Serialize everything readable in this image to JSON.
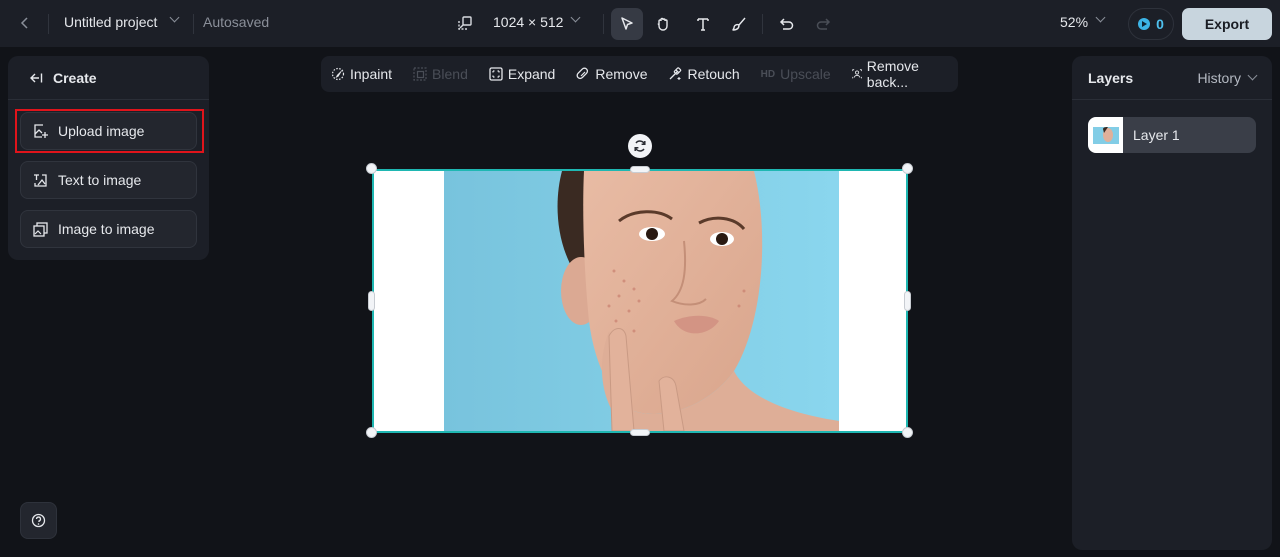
{
  "topbar": {
    "back_icon": "chevron-left-icon",
    "project_title": "Untitled project",
    "save_status": "Autosaved",
    "canvas_size": "1024 × 512",
    "tools": [
      {
        "name": "select",
        "icon": "cursor-icon",
        "active": true
      },
      {
        "name": "hand",
        "icon": "hand-icon",
        "active": false
      },
      {
        "name": "text",
        "icon": "text-icon",
        "active": false
      },
      {
        "name": "brush",
        "icon": "brush-icon",
        "active": false
      },
      {
        "name": "undo",
        "icon": "undo-icon",
        "active": false
      },
      {
        "name": "redo",
        "icon": "redo-icon",
        "active": false,
        "disabled": true
      }
    ],
    "zoom": "52%",
    "credits": "0",
    "export_label": "Export"
  },
  "left_panel": {
    "title": "Create",
    "items": [
      {
        "label": "Upload image",
        "icon": "upload-image-icon",
        "highlighted": true
      },
      {
        "label": "Text to image",
        "icon": "text-to-image-icon"
      },
      {
        "label": "Image to image",
        "icon": "image-to-image-icon"
      }
    ]
  },
  "toolsbar": {
    "items": [
      {
        "label": "Inpaint",
        "icon": "inpaint-icon",
        "enabled": true
      },
      {
        "label": "Blend",
        "icon": "blend-icon",
        "enabled": false
      },
      {
        "label": "Expand",
        "icon": "expand-icon",
        "enabled": true
      },
      {
        "label": "Remove",
        "icon": "eraser-icon",
        "enabled": true
      },
      {
        "label": "Retouch",
        "icon": "retouch-icon",
        "enabled": true
      },
      {
        "label": "Upscale",
        "badge": "HD",
        "icon": "hd-icon",
        "enabled": false
      },
      {
        "label": "Remove back...",
        "icon": "remove-background-icon",
        "enabled": true
      }
    ]
  },
  "right_panel": {
    "title": "Layers",
    "history_label": "History",
    "layers": [
      {
        "name": "Layer 1"
      }
    ]
  },
  "colors": {
    "accent_selection": "#1fb7b2",
    "export_bg": "#c8d5de",
    "highlight_border": "#e0141b",
    "credit_blue": "#4ec0ee"
  }
}
